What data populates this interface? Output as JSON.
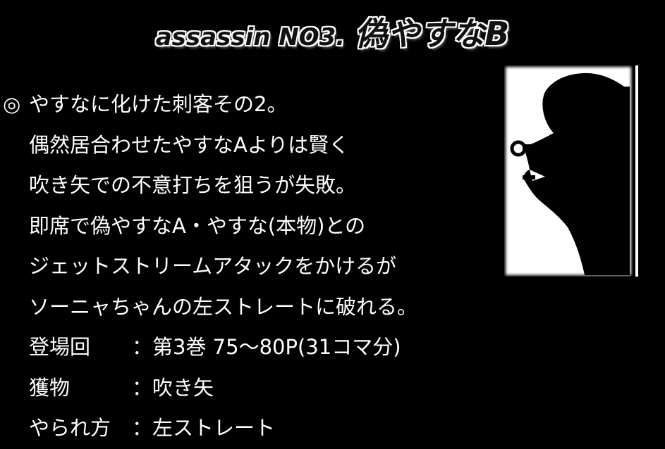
{
  "title": {
    "prefix": "assassin NO3.",
    "name": "偽やすなB"
  },
  "description": {
    "bullet": "◎",
    "lines": [
      "やすなに化けた刺客その2。",
      "偶然居合わせたやすなAよりは賢く",
      "吹き矢での不意打ちを狙うが失敗。",
      "即席で偽やすなA・やすな(本物)との",
      "ジェットストリームアタックをかけるが",
      "ソーニャちゃんの左ストレートに破れる。"
    ]
  },
  "details": [
    {
      "label": "登場回",
      "colon": "：",
      "value": "第3巻 75～80P(31コマ分)"
    },
    {
      "label": "獲物",
      "colon": "：",
      "value": "吹き矢"
    },
    {
      "label": "やられ方",
      "colon": "：",
      "value": "左ストレート"
    }
  ],
  "silhouette_icon": "masked-assassin-silhouette-icon",
  "colors": {
    "background": "#000000",
    "text": "#ffffff"
  }
}
